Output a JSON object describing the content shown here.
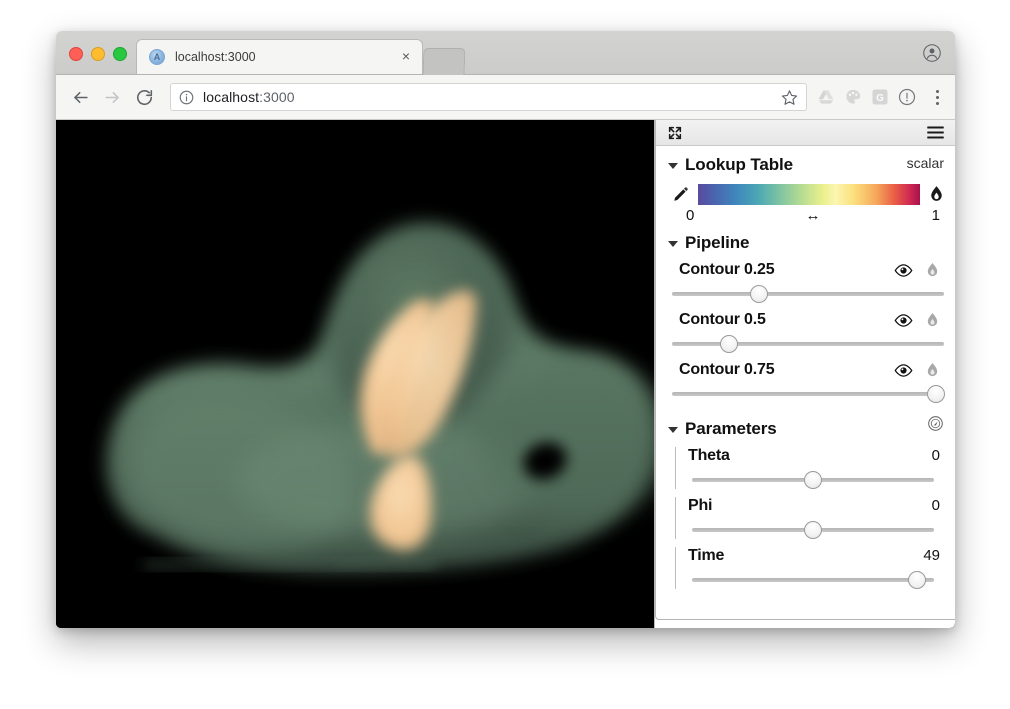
{
  "browser": {
    "tab": {
      "title": "localhost:3000",
      "favicon_name": "app-favicon",
      "close_label": "×"
    },
    "toolbar": {
      "back_icon": "back-arrow-icon",
      "forward_icon": "forward-arrow-icon",
      "reload_icon": "reload-icon",
      "site_info_icon": "site-info-icon",
      "url_host": "localhost",
      "url_port": ":3000",
      "url_full": "localhost:3000",
      "bookmark_icon": "star-icon",
      "extensions": [
        "drive-extension-icon",
        "paint-extension-icon",
        "grammarly-extension-icon",
        "info-extension-icon"
      ],
      "menu_icon": "kebab-menu-icon"
    },
    "profile_icon": "profile-avatar-icon"
  },
  "panel": {
    "titlebar": {
      "expand_icon": "expand-arrows-icon",
      "menu_icon": "hamburger-menu-icon"
    },
    "lookup_table": {
      "title": "Lookup Table",
      "mode": "scalar",
      "edit_icon": "pencil-icon",
      "opacity_icon": "droplet-icon",
      "range_min": "0",
      "range_max": "1",
      "range_arrows": "↔",
      "colormap_name": "rainbow-spectral",
      "colors": [
        "#5b4a9e",
        "#3f86bc",
        "#7fc4a2",
        "#e9f08c",
        "#fbf6b0",
        "#f6a95c",
        "#d22b52",
        "#a8114d"
      ]
    },
    "pipeline": {
      "title": "Pipeline",
      "items": [
        {
          "label": "Contour 0.25",
          "visibility_icon": "eye-icon",
          "opacity_icon": "droplet-icon",
          "slider_percent": 32
        },
        {
          "label": "Contour 0.5",
          "visibility_icon": "eye-icon",
          "opacity_icon": "droplet-icon",
          "slider_percent": 21
        },
        {
          "label": "Contour 0.75",
          "visibility_icon": "eye-icon",
          "opacity_icon": "droplet-icon",
          "slider_percent": 97
        }
      ]
    },
    "parameters": {
      "title": "Parameters",
      "play_icon": "play-circle-icon",
      "items": [
        {
          "label": "Theta",
          "value": "0",
          "slider_percent": 50
        },
        {
          "label": "Phi",
          "value": "0",
          "slider_percent": 50
        },
        {
          "label": "Time",
          "value": "49",
          "slider_percent": 93
        }
      ]
    }
  },
  "viewport": {
    "background": "#000000",
    "surface_color": "#46604f",
    "highlight_color": "#f3cd9a"
  }
}
